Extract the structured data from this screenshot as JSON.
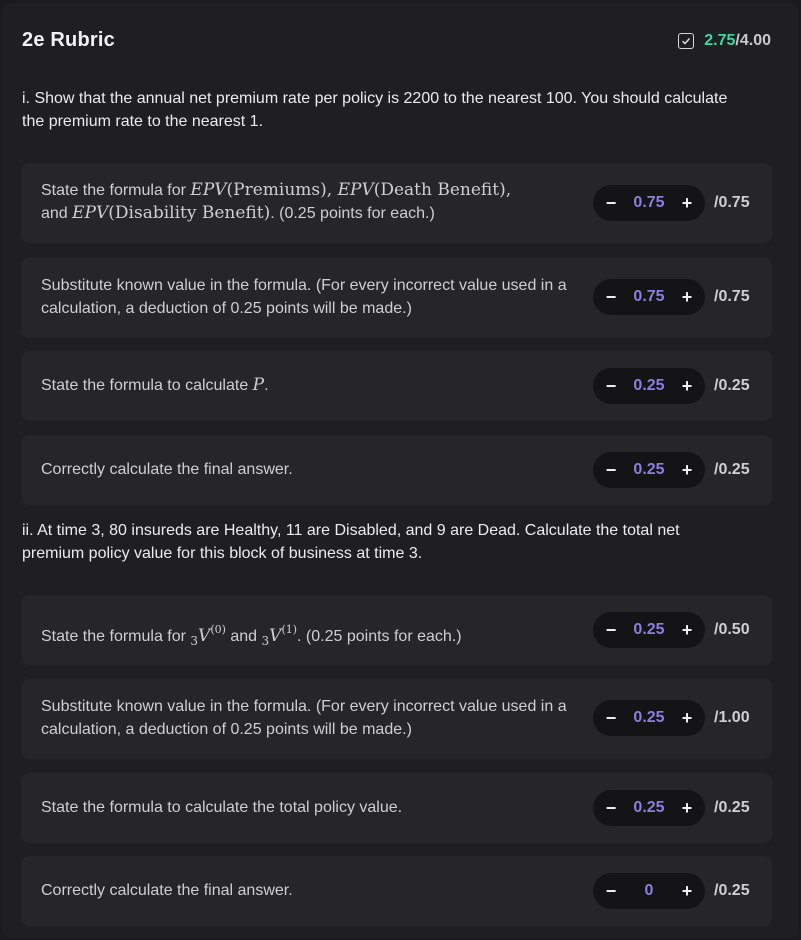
{
  "header": {
    "title": "2e Rubric",
    "score_got": "2.75",
    "score_slash": "/",
    "score_total": "4.00"
  },
  "questions": [
    {
      "text": "i. Show that the annual net premium rate per policy is 2200 to the nearest 100. You should calculate the premium rate to the nearest 1."
    },
    {
      "text": "ii. At time 3, 80 insureds are Healthy, 11 are Disabled, and 9 are Dead. Calculate the total net premium policy value for this block of business at time 3."
    }
  ],
  "items": [
    {
      "prefix": "State the formula for ",
      "math1": "EPV",
      "math1b": "(Premiums), ",
      "math2": "EPV",
      "math2b": "(Death Benefit),",
      "mid": " and ",
      "math3": "EPV",
      "math3b": "(Disability Benefit)",
      "suffix": ". (0.25 points for each.)",
      "value": "0.75",
      "max": "/0.75"
    },
    {
      "text": "Substitute known value in the formula. (For every incorrect value used in a calculation, a deduction of 0.25 points will be made.)",
      "value": "0.75",
      "max": "/0.75"
    },
    {
      "prefix": "State the formula to calculate ",
      "math": "P",
      "suffix": ".",
      "value": "0.25",
      "max": "/0.25"
    },
    {
      "text": "Correctly calculate the final answer.",
      "value": "0.25",
      "max": "/0.25"
    },
    {
      "prefix": "State the formula for ",
      "sub1": "3",
      "v1": "V",
      "sup1": "(0)",
      "mid": " and ",
      "sub2": "3",
      "v2": "V",
      "sup2": "(1)",
      "suffix": ". (0.25 points for each.)",
      "value": "0.25",
      "max": "/0.50"
    },
    {
      "text": "Substitute known value in the formula. (For every incorrect value used in a calculation, a deduction of 0.25 points will be made.)",
      "value": "0.25",
      "max": "/1.00"
    },
    {
      "text": "State the formula to calculate the total policy value.",
      "value": "0.25",
      "max": "/0.25"
    },
    {
      "text": "Correctly calculate the final answer.",
      "value": "0",
      "max": "/0.25"
    }
  ],
  "controls": {
    "minus": "−",
    "plus": "+"
  },
  "icons": {
    "score": "checkbox-checked-icon"
  },
  "colors": {
    "score": "#3fd6a0",
    "value": "#8b7fe0"
  }
}
